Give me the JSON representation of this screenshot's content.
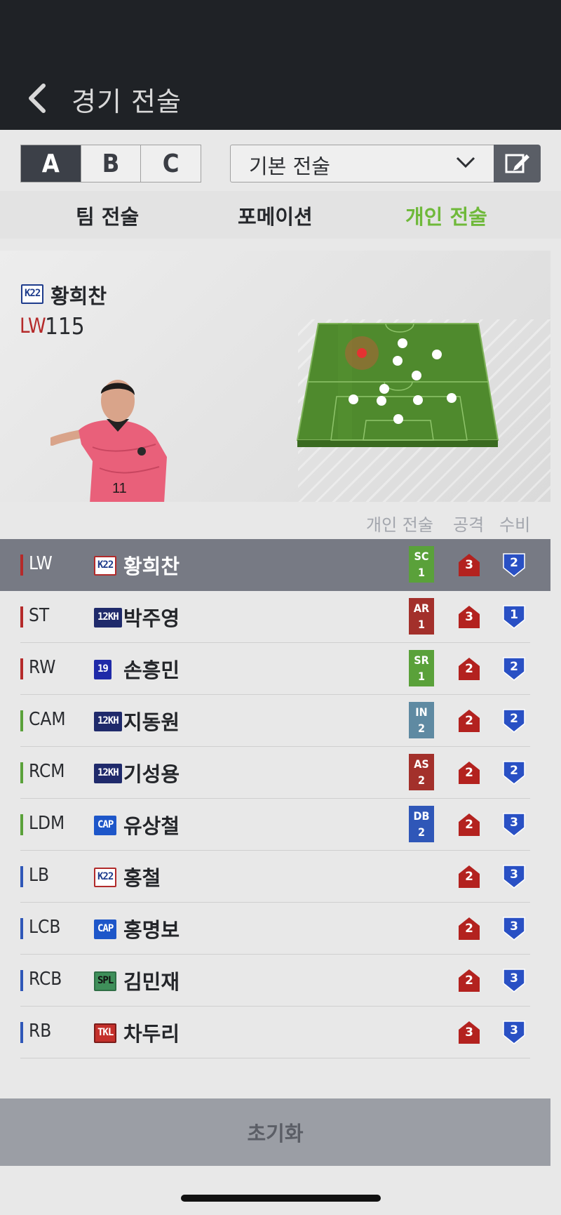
{
  "header": {
    "title": "경기 전술"
  },
  "presets": {
    "slots": [
      "A",
      "B",
      "C"
    ],
    "selected": "A",
    "dropdown_value": "기본 전술"
  },
  "tabs": [
    {
      "label": "팀 전술",
      "active": false
    },
    {
      "label": "포메이션",
      "active": false
    },
    {
      "label": "개인 전술",
      "active": true
    }
  ],
  "hero": {
    "badge": "K22",
    "name": "황희찬",
    "position": "LW",
    "ovr": "115"
  },
  "columns": {
    "tactic": "개인 전술",
    "attack": "공격",
    "defense": "수비"
  },
  "players": [
    {
      "pos": "LW",
      "pos_color": "#b52a2a",
      "badge": "K22",
      "name": "황희찬",
      "tactic": "SC",
      "tactic_level": "1",
      "tactic_color": "#5aa13a",
      "attack": "3",
      "defense": "2",
      "selected": true
    },
    {
      "pos": "ST",
      "pos_color": "#b52a2a",
      "badge": "12KH",
      "name": "박주영",
      "tactic": "AR",
      "tactic_level": "1",
      "tactic_color": "#a3302b",
      "attack": "3",
      "defense": "1"
    },
    {
      "pos": "RW",
      "pos_color": "#b52a2a",
      "badge": "19",
      "name": "손흥민",
      "tactic": "SR",
      "tactic_level": "1",
      "tactic_color": "#5aa13a",
      "attack": "2",
      "defense": "2"
    },
    {
      "pos": "CAM",
      "pos_color": "#5aa13a",
      "badge": "12KH",
      "name": "지동원",
      "tactic": "IN",
      "tactic_level": "2",
      "tactic_color": "#5f8aa2",
      "attack": "2",
      "defense": "2"
    },
    {
      "pos": "RCM",
      "pos_color": "#5aa13a",
      "badge": "12KH",
      "name": "기성용",
      "tactic": "AS",
      "tactic_level": "2",
      "tactic_color": "#a3302b",
      "attack": "2",
      "defense": "2"
    },
    {
      "pos": "LDM",
      "pos_color": "#5aa13a",
      "badge": "CAP",
      "name": "유상철",
      "tactic": "DB",
      "tactic_level": "2",
      "tactic_color": "#2f57b8",
      "attack": "2",
      "defense": "3"
    },
    {
      "pos": "LB",
      "pos_color": "#2f57b8",
      "badge": "K22",
      "name": "홍철",
      "tactic": "",
      "tactic_level": "",
      "tactic_color": "",
      "attack": "2",
      "defense": "3"
    },
    {
      "pos": "LCB",
      "pos_color": "#2f57b8",
      "badge": "CAP",
      "name": "홍명보",
      "tactic": "",
      "tactic_level": "",
      "tactic_color": "",
      "attack": "2",
      "defense": "3"
    },
    {
      "pos": "RCB",
      "pos_color": "#2f57b8",
      "badge": "SPL",
      "name": "김민재",
      "tactic": "",
      "tactic_level": "",
      "tactic_color": "",
      "attack": "2",
      "defense": "3"
    },
    {
      "pos": "RB",
      "pos_color": "#2f57b8",
      "badge": "TKL",
      "name": "차두리",
      "tactic": "",
      "tactic_level": "",
      "tactic_color": "",
      "attack": "3",
      "defense": "3"
    }
  ],
  "reset_label": "초기화",
  "colors": {
    "accent": "#6fb93a",
    "attack": "#b3221f",
    "defense": "#2950c4"
  }
}
